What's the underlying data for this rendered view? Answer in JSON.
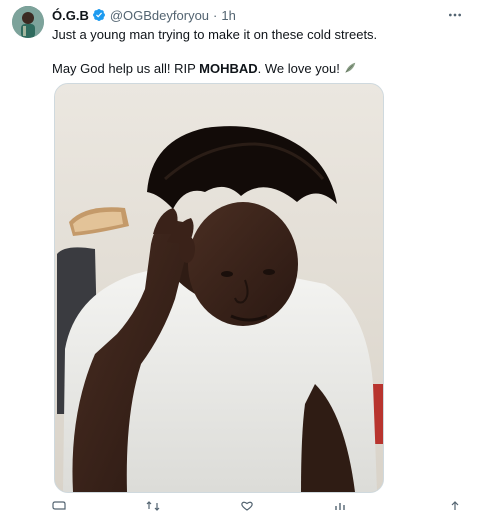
{
  "tweet": {
    "display_name": "Ó.G.B",
    "handle": "@OGBdeyforyou",
    "separator": "·",
    "time": "1h",
    "text_line1": "Just a young man trying to make it on these cold streets.",
    "text_line2_prefix": "May God help us all! RIP ",
    "text_line2_bold": "MOHBAD",
    "text_line2_suffix": ". We love you!",
    "verified_color": "#1d9bf0"
  },
  "icons": {
    "more": "more-options-icon",
    "verified": "verified-badge-icon",
    "leaf": "leaf-emoji-icon",
    "reply": "reply-icon",
    "retweet": "retweet-icon",
    "like": "like-icon",
    "views": "views-icon",
    "bookmark": "bookmark-icon"
  }
}
